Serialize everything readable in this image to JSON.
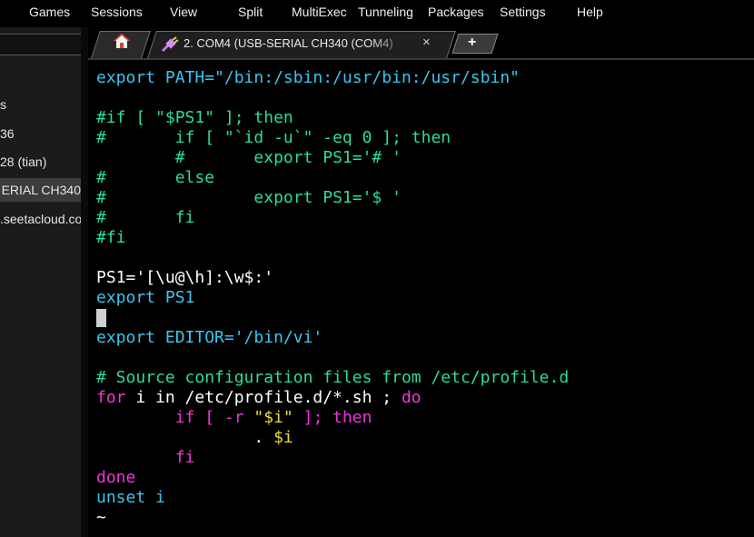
{
  "menubar": {
    "items": [
      "Games",
      "Sessions",
      "View",
      "Split",
      "MultiExec",
      "Tunneling",
      "Packages",
      "Settings",
      "Help"
    ]
  },
  "sidebar": {
    "items": [
      {
        "label": "s"
      },
      {
        "label": "36"
      },
      {
        "label": "28 (tian)"
      },
      {
        "label": "ERIAL CH340"
      },
      {
        "label": ".seetacloud.co"
      }
    ],
    "selected_index": 3
  },
  "tabs": {
    "home_icon": "home-icon",
    "session_icon": "plug-icon",
    "session_label": "2. COM4  (USB-SERIAL CH340 (COM4)",
    "close_label": "×",
    "add_label": "+"
  },
  "terminal": {
    "lines": [
      [
        {
          "t": "export PATH=\"/bin:/sbin:/usr/bin:/usr/sbin\"",
          "c": "cyan"
        }
      ],
      [
        {
          "t": "",
          "c": "white"
        }
      ],
      [
        {
          "t": "#if [ \"$PS1\" ]; then",
          "c": "green"
        }
      ],
      [
        {
          "t": "#       if [ \"`id -u`\" -eq 0 ]; then",
          "c": "green"
        }
      ],
      [
        {
          "t": "        #       export PS1='# '",
          "c": "green"
        }
      ],
      [
        {
          "t": "#       else",
          "c": "green"
        }
      ],
      [
        {
          "t": "#               export PS1='$ '",
          "c": "green"
        }
      ],
      [
        {
          "t": "#       fi",
          "c": "green"
        }
      ],
      [
        {
          "t": "#fi",
          "c": "green"
        }
      ],
      [
        {
          "t": "",
          "c": "white"
        }
      ],
      [
        {
          "t": "PS1='[\\u@\\h]:\\w$:'",
          "c": "white"
        }
      ],
      [
        {
          "t": "export PS1",
          "c": "cyan"
        }
      ],
      [
        {
          "t": "",
          "c": "cursor"
        }
      ],
      [
        {
          "t": "export EDITOR='/bin/vi'",
          "c": "cyan"
        }
      ],
      [
        {
          "t": "",
          "c": "white"
        }
      ],
      [
        {
          "t": "# Source configuration files from /etc/profile.d",
          "c": "green"
        }
      ],
      [
        {
          "t": "for",
          "c": "magenta"
        },
        {
          "t": " i in /etc/profile.d/*.sh ; ",
          "c": "white"
        },
        {
          "t": "do",
          "c": "magenta"
        }
      ],
      [
        {
          "t": "        ",
          "c": "white"
        },
        {
          "t": "if [ -r ",
          "c": "magenta"
        },
        {
          "t": "\"$i\"",
          "c": "yellow"
        },
        {
          "t": " ]; then",
          "c": "magenta"
        }
      ],
      [
        {
          "t": "                . ",
          "c": "white"
        },
        {
          "t": "$i",
          "c": "yellow"
        }
      ],
      [
        {
          "t": "        ",
          "c": "white"
        },
        {
          "t": "fi",
          "c": "magenta"
        }
      ],
      [
        {
          "t": "done",
          "c": "magenta"
        }
      ],
      [
        {
          "t": "unset i",
          "c": "cyan"
        }
      ],
      [
        {
          "t": "~",
          "c": "white"
        }
      ]
    ]
  },
  "colors": {
    "cyan": "#3ac6ef",
    "green": "#27de9b",
    "magenta": "#f233dd",
    "yellow": "#e7df2c",
    "background": "#000000"
  }
}
